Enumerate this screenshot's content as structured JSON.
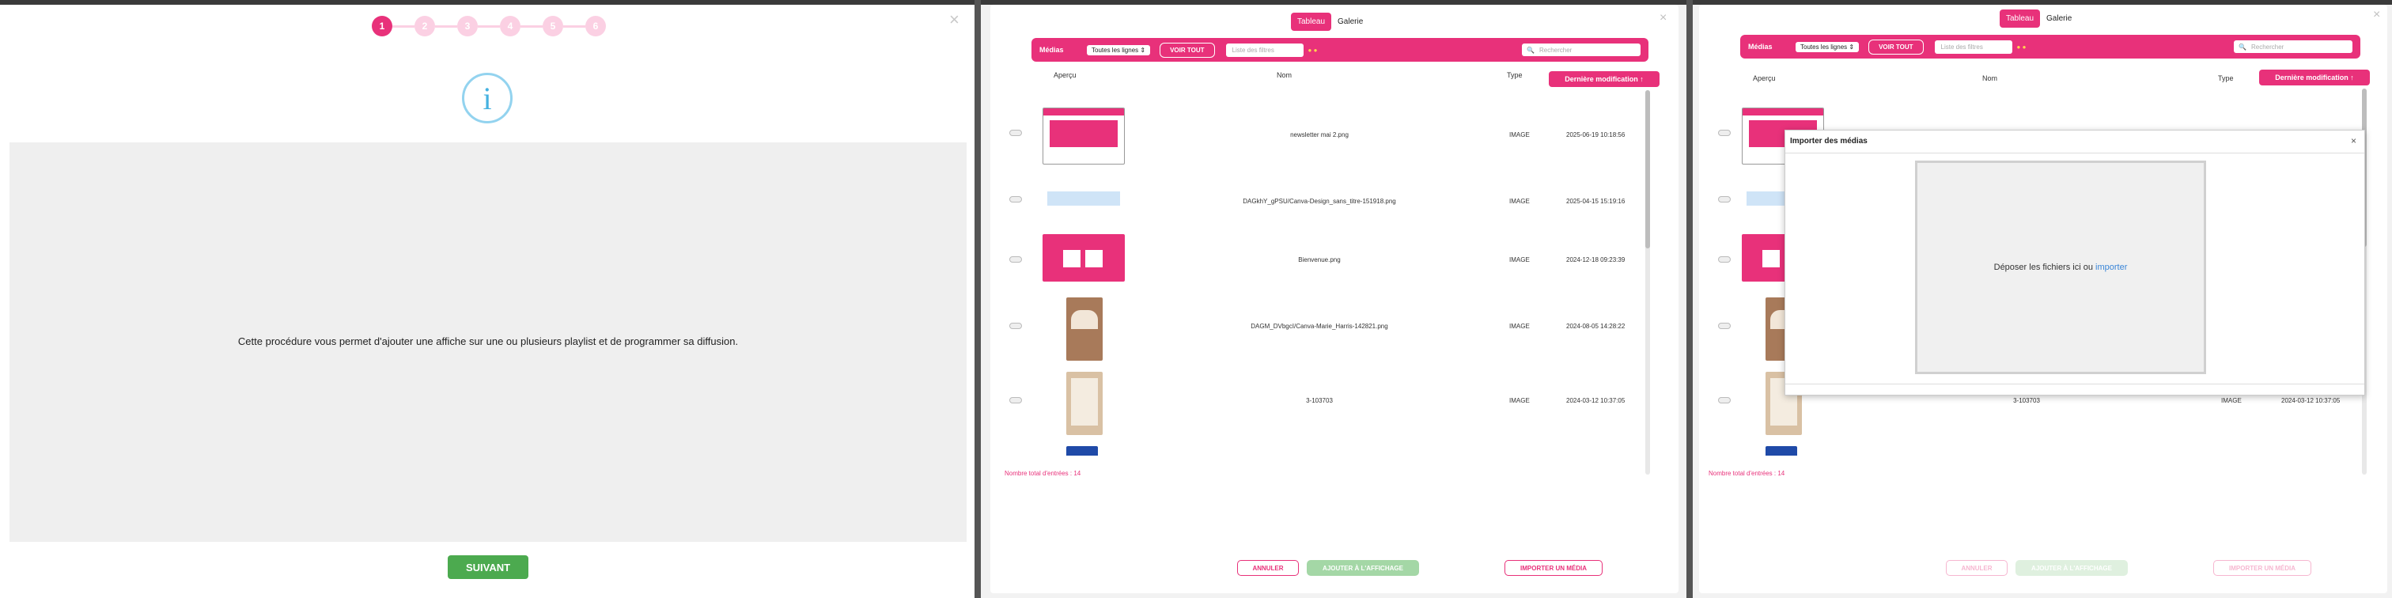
{
  "wizard": {
    "close": "×",
    "steps": [
      "1",
      "2",
      "3",
      "4",
      "5",
      "6"
    ],
    "info_icon": "i",
    "text": "Cette procédure vous permet d'ajouter une affiche sur une ou plusieurs playlist et de programmer sa diffusion.",
    "next_label": "SUIVANT"
  },
  "media": {
    "close": "×",
    "tabs": [
      "Tableau",
      "Galerie"
    ],
    "filter": {
      "title": "Médias",
      "lines_select": "Toutes les lignes",
      "view_all": "VOIR TOUT",
      "titles_placeholder": "Liste des filtres",
      "search_placeholder": "Rechercher"
    },
    "columns": [
      "Aperçu",
      "Nom",
      "Type",
      "Dernière modification"
    ],
    "sort_arrow": "↑",
    "rows": [
      {
        "name": "newsletter mai 2.png",
        "type": "IMAGE",
        "date": "2025-06-19 10:18:56"
      },
      {
        "name": "DAGkhY_gPSU/Canva-Design_sans_titre-151918.png",
        "type": "IMAGE",
        "date": "2025-04-15 15:19:16"
      },
      {
        "name": "Bienvenue.png",
        "type": "IMAGE",
        "date": "2024-12-18 09:23:39"
      },
      {
        "name": "DAGM_DVbgcI/Canva-Marie_Harris-142821.png",
        "type": "IMAGE",
        "date": "2024-08-05 14:28:22"
      },
      {
        "name": "3-103703",
        "type": "IMAGE",
        "date": "2024-03-12 10:37:05"
      },
      {
        "name": "",
        "type": "",
        "date": ""
      }
    ],
    "total_label": "Nombre total d'entrées : 14",
    "buttons": {
      "cancel": "ANNULER",
      "add": "AJOUTER À L'AFFICHAGE",
      "import": "IMPORTER UN MÉDIA"
    }
  },
  "import_modal": {
    "title": "Importer des médias",
    "close": "×",
    "drop_text": "Déposer les fichiers ici ou",
    "drop_link": "importer"
  },
  "colors": {
    "accent": "#e8317a",
    "success": "#4caa4f",
    "info": "#45b1e0",
    "link": "#3b86d8"
  }
}
